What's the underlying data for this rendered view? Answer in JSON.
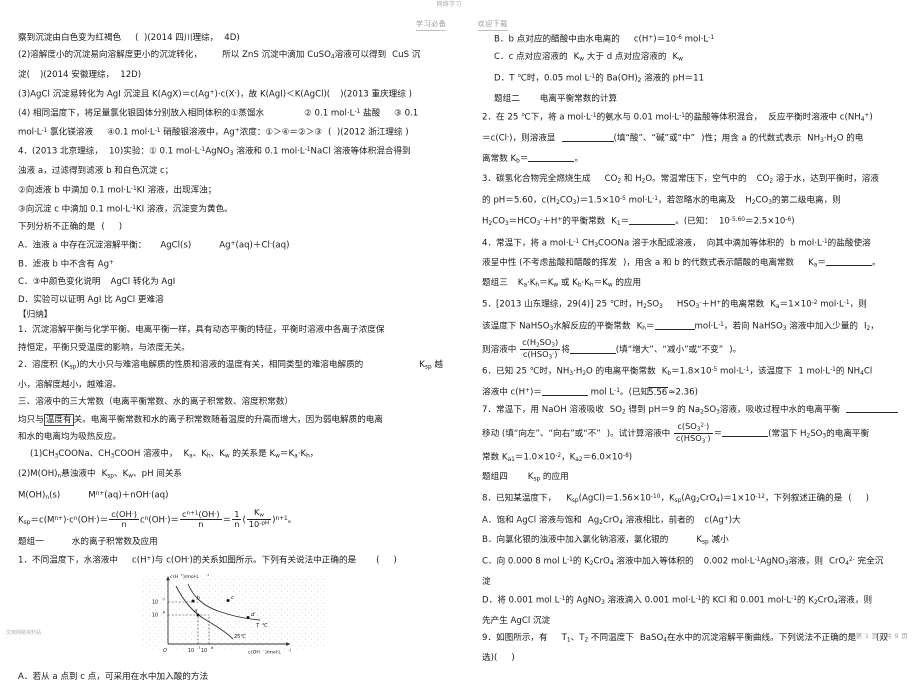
{
  "header": {
    "watermark_logo": "网络学习",
    "watermark_sub": "· · · · · · · ·",
    "left_label": "学习必备",
    "right_label": "欢迎下载"
  },
  "footer": {
    "watermark_logo": "文库网络资料站",
    "watermark_sub": "· · · · · ·",
    "page_label": "第 1 页，共 9 页"
  },
  "left_column": {
    "lines": [
      "察到沉淀由白色变为红褐色",
      "(2014 四川理综，4D)",
      "(2)溶解度小的沉淀易向溶解度更小的沉淀转化，所以 ZnS 沉淀中滴加 CuSO₄溶液可以得到 CuS 沉淀(  )(2014 安徽理综，12D)",
      "(3)AgCl 沉淀易转化为 AgI 沉淀且 K(AgX)＝c(Ag⁺)·c(X⁻)，故 K(AgI)＜K(AgCl)(  )(2013 重庆理综 )",
      "(4) 相同温度下，将足量氯化银固体分别放入相同体积的①蒸馏水  ② 0.1 mol·L⁻¹ 盐酸  ③ 0.1 mol·L⁻¹ 氯化镁溶液  ④0.1 mol·L⁻¹ 硝酸银溶液中，Ag⁺浓度：①＞④＝②＞③ (  )(2012 浙江理综 )",
      "4. (2013 北京理综，10)实验：① 0.1 mol·L⁻¹AgNO₃溶液和 0.1 mol·L⁻¹NaCl 溶液等体积混合得到浊液 a，过滤得到滤液 b 和白色沉淀 c；",
      "②向滤液 b 中滴加 0.1 mol·L⁻¹KI 溶液，出现浑浊；",
      "③向沉淀 c 中滴加 0.1 mol·L⁻¹KI 溶液，沉淀变为黄色。",
      "下列分析不正确的是  (   )",
      "A．浊液 a 中存在沉淀溶解平衡：AgCl(s)    Ag⁺(aq)＋Cl⁻(aq)",
      "B．滤液 b 中不含有 Ag⁺",
      "C．③中颜色变化说明 AgCl 转化为 AgI",
      "D．实验可以证明 AgI 比 AgCl 更难溶",
      "【归纳】",
      "1．沉淀溶解平衡与化学平衡、电离平衡一样，具有动态平衡的特征，平衡时溶液中各离子浓度保持恒定，平衡只受温度的影响，与浓度无关。",
      "2．溶度积 (Ksp)的大小只与难溶电解质的性质和溶液的温度有关，相同类型的难溶电解质的 Ksp 越小，溶解度越小，越难溶。",
      "三、溶液中的三大常数（电离平衡常数、水的离子积常数、溶度积常数）",
      "均只与温度有关。电离平衡常数和水的离子积常数随着温度的升高而增大，因为弱电解质的电离和水的电离均为吸热反应。",
      "(1)CH₃COONa、CH₃COOH 溶液中，Ka、Kh、Kw 的关系是 Kw＝Ka·Kh，",
      "(2)M(OH)n 悬浊液中 Ksp、Kw、pH 间关系",
      "M(OH)n(s)    Mⁿ⁺(aq)＋nOH⁻(aq)",
      "题组一   水的离子积常数及应用",
      "1．不同温度下，水溶液中 c(H⁺)与 c(OH⁻)的关系如图所示。下列有关说法中正确的是  (   )",
      "A．若从 a 点到 c 点，可采用在水中加入酸的方法"
    ],
    "boxed_text": "温度有"
  },
  "right_column": {
    "lines": [
      "B．b 点对应的醋酸中由水电离的 c(H⁺)＝10⁻⁶ mol·L⁻¹",
      "C．c 点对应溶液的 Kw 大于 d 点对应溶液的 Kw",
      "D．T ℃时，0.05 mol L⁻¹的 Ba(OH)₂溶液的 pH＝11",
      "题组二   电离平衡常数的计算",
      "2. 在 25 ℃下，将 a mol·L⁻¹的氨水与 0.01 mol·L⁻¹的盐酸等体积混合，反应平衡时溶液中 c(NH₄⁺)＝c(Cl⁻)，则溶液显 ______(填“酸”、“碱”或“中”)性；用含 a 的代数式表示 NH₃·H₂O 的电离常数 Kb＝______。",
      "3．碳氢化合物完全燃烧生成 CO₂和 H₂O。常温常压下，空气中的 CO₂溶于水，达到平衡时，溶液的 pH＝5.60，c(H₂CO₃)＝1.5×10⁻⁵ mol·L⁻¹，若忽略水的电离及 H₂CO₃的第二级电离，则 H₂CO₃＝HCO₃⁻＋H⁺的平衡常数 K₁＝______。(已知：10⁻⁵·⁶⁰＝2.5×10⁻⁶)",
      "4．常温下，将 a mol·L⁻¹ CH₃COONa 溶于水配成溶液，向其中滴加等体积的 b mol·L⁻¹的盐酸使溶液呈中性 (不考虑盐酸和醋酸的挥发)，用含 a 和 b 的代数式表示醋酸的电离常数 Ka＝______。",
      "题组三   Ka·Kh＝Kw 或 Kb·Kh＝Kw 的应用",
      "5．[2013 山东理综，29(4)] 25 ℃时，H₂SO₃  HSO₃⁻＋H⁺的电离常数 Ka＝1×10⁻² mol·L⁻¹，则该温度下 NaHSO₃水解反应的平衡常数 Kh＝____mol·L⁻¹，若向 NaHSO₃溶液中加入少量的 I₂，则溶液中 c(H₂SO₃)/c(HSO₃⁻)将______(填“增大”、“减小”或“不变”)。",
      "6．已知 25 ℃时，NH₃·H₂O 的电离平衡常数 Kb＝1.8×10⁻⁵ mol·L⁻¹，该温度下 1 mol·L⁻¹的 NH₄Cl 溶液中 c(H⁺)＝______ mol L⁻¹。(已知√5.56≈2.36)",
      "7．常温下，用 NaOH 溶液吸收 SO₂得到 pH＝9 的 Na₂SO₃溶液，吸收过程中水的电离平衡______移动 (填“向左”、“向右”或“不”)。试计算溶液中 c(SO₃²⁻)/c(HSO₃⁻)＝______(常温下 H₂SO₃的电离平衡常数 Ka1＝1.0×10⁻²，Ka2＝6.0×10⁻⁸)",
      "题组四   Ksp 的应用",
      "8．已知某温度下，Ksp(AgCl)＝1.56×10⁻¹⁰，Ksp(Ag₂CrO₄)＝1×10⁻¹²，下列叙述正确的是  (   )",
      "A．饱和 AgCl 溶液与饱和 Ag₂CrO₄溶液相比，前者的 c(Ag⁺)大",
      "B．向氯化银的浊液中加入氯化钠溶液，氯化银的 Ksp 减小",
      "C．向 0.000 8 mol L⁻¹的 K₂CrO₄溶液中加入等体积的 0.002 mol·L⁻¹AgNO₃溶液，则 CrO₄²⁻完全沉淀",
      "D．将 0.001 mol L⁻¹的 AgNO₃溶液滴入 0.001 mol·L⁻¹的 KCl 和 0.001 mol·L⁻¹的 K₂CrO₄溶液，则先产生 AgCl 沉淀",
      "9．如图所示，有 T₁、T₂不同温度下 BaSO₄在水中的沉淀溶解平衡曲线。下列说法不正确的是  (双选)(   )"
    ]
  },
  "chart_data": {
    "type": "line",
    "title": "",
    "ylabel": "c(H⁺)/mol·L⁻¹",
    "xlabel": "c(OH⁻)/mol·L⁻¹",
    "origin_label": "O",
    "ytick_labels": [
      "10⁻⁷",
      "10⁻⁶"
    ],
    "xtick_labels": [
      "10⁻⁷",
      "10⁻⁶"
    ],
    "series": [
      {
        "name": "T ℃",
        "note": "上方曲线（高温，Kw 较大）"
      },
      {
        "name": "25 ℃",
        "note": "下方曲线（常温，Kw 较小）"
      }
    ],
    "points": [
      {
        "label": "b",
        "curve": "T ℃"
      },
      {
        "label": "c",
        "curve": "T ℃"
      },
      {
        "label": "a",
        "curve": "25 ℃"
      },
      {
        "label": "d",
        "curve": "T ℃"
      }
    ],
    "grid": false,
    "legend_position": "inline-labels"
  }
}
